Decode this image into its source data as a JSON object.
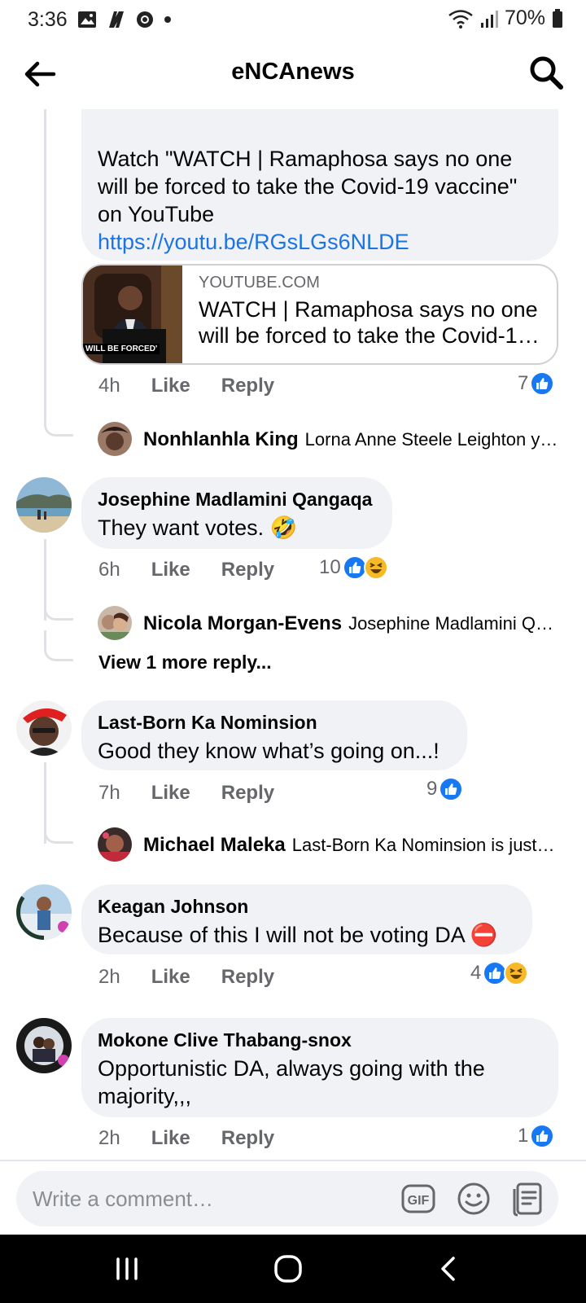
{
  "status": {
    "time": "3:36",
    "battery": "70%"
  },
  "header": {
    "title": "eNCAnews"
  },
  "top_comment": {
    "text": "Watch \"WATCH | Ramaphosa says no one will be forced to take the Covid-19 vaccine\" on YouTube",
    "link": "https://youtu.be/RGsLGs6NLDE",
    "preview": {
      "domain": "YOUTUBE.COM",
      "title": "WATCH | Ramaphosa says no one will be forced to take the Covid-1…",
      "thumb_caption": "WILL BE FORCED'"
    },
    "time": "4h",
    "like": "Like",
    "reply": "Reply",
    "reaction_count": "7"
  },
  "reply_1": {
    "name": "Nonhlanhla King",
    "text": "Lorna Anne Steele Leighton ye…"
  },
  "comments": [
    {
      "author": "Josephine Madlamini Qangaqa",
      "text": "They want votes.",
      "emoji": "🤣",
      "time": "6h",
      "like": "Like",
      "reply": "Reply",
      "reaction_count": "10",
      "replies": [
        {
          "name": "Nicola Morgan-Evens",
          "text": "Josephine Madlamini Q…"
        }
      ],
      "view_more": "View 1 more reply..."
    },
    {
      "author": "Last-Born Ka Nominsion",
      "text": "Good they know what’s going on...!",
      "time": "7h",
      "like": "Like",
      "reply": "Reply",
      "reaction_count": "9",
      "replies": [
        {
          "name": "Michael Maleka",
          "text": "Last-Born Ka Nominsion is just…"
        }
      ]
    },
    {
      "author": "Keagan Johnson",
      "text": "Because of this I will not be voting DA",
      "emoji": "⛔",
      "time": "2h",
      "like": "Like",
      "reply": "Reply",
      "reaction_count": "4"
    },
    {
      "author": "Mokone Clive Thabang-snox",
      "text": "Opportunistic DA, always going with the majority,,,",
      "time": "2h",
      "like": "Like",
      "reply": "Reply",
      "reaction_count": "1"
    }
  ],
  "composer": {
    "placeholder": "Write a comment…",
    "gif_label": "GIF"
  },
  "colors": {
    "link": "#1b74e4",
    "like_blue": "#1877f2",
    "haha_yellow": "#f7b928",
    "bubble": "#f0f2f5",
    "secondary_text": "#65676b"
  }
}
